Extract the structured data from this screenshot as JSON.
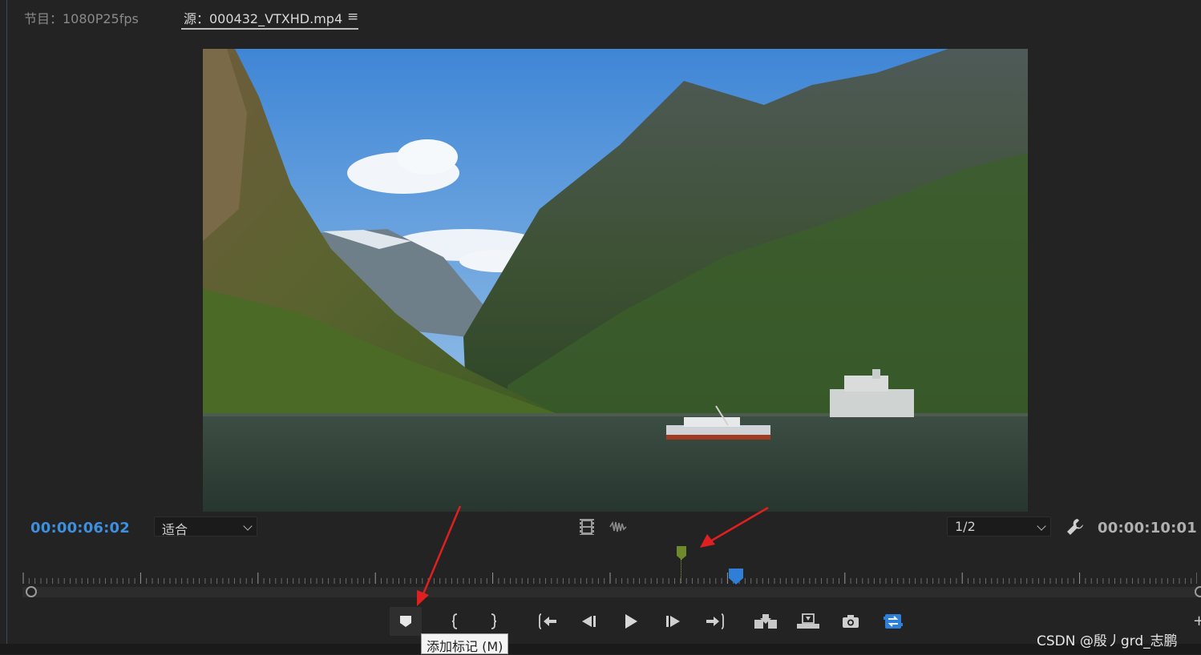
{
  "tabs": {
    "program": "节目：1080P25fps",
    "source": "源：000432_VTXHD.mp4",
    "menu_icon": "hamburger-menu-icon"
  },
  "monitor": {
    "current_timecode": "00:00:06:02",
    "duration_timecode": "00:00:10:01",
    "zoom_select": {
      "selected": "适合"
    },
    "resolution_select": {
      "selected": "1/2"
    },
    "playhead_fraction": 0.608,
    "marker_fraction": 0.563
  },
  "controls": [
    {
      "name": "add-marker-button",
      "icon": "marker-icon"
    },
    {
      "name": "mark-in-button",
      "icon": "mark-in-icon"
    },
    {
      "name": "mark-out-button",
      "icon": "mark-out-icon"
    },
    {
      "name": "go-to-in-button",
      "icon": "go-to-in-icon"
    },
    {
      "name": "step-back-button",
      "icon": "step-back-icon"
    },
    {
      "name": "play-button",
      "icon": "play-icon"
    },
    {
      "name": "step-forward-button",
      "icon": "step-forward-icon"
    },
    {
      "name": "go-to-out-button",
      "icon": "go-to-out-icon"
    },
    {
      "name": "insert-button",
      "icon": "insert-icon"
    },
    {
      "name": "overwrite-button",
      "icon": "overwrite-icon"
    },
    {
      "name": "export-frame-button",
      "icon": "camera-icon"
    },
    {
      "name": "button-editor-button",
      "icon": "button-editor-icon"
    }
  ],
  "tooltip": "添加标记 (M)",
  "watermark": "CSDN @殷丿grd_志鹏",
  "colors": {
    "timecode_accent": "#3d8fe0",
    "marker_green": "#6f8a2c",
    "playhead_blue": "#2f7fd8",
    "annotation_red": "#e02020"
  }
}
